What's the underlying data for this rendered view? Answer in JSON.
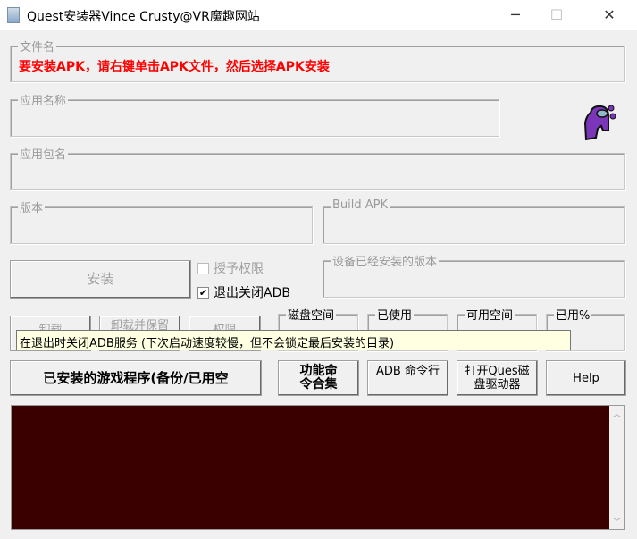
{
  "window": {
    "title": "Quest安装器Vince Crusty@VR魔趣网站",
    "minimize": "─",
    "maximize": "☐",
    "close": "✕"
  },
  "file_group": {
    "label": "文件名",
    "message": "要安装APK，请右键单击APK文件，然后选择APK安装",
    "message_color": "#ff0000"
  },
  "app_name": {
    "label": "应用名称"
  },
  "package_name": {
    "label": "应用包名"
  },
  "version": {
    "label": "版本"
  },
  "build_apk": {
    "label": "Build APK"
  },
  "install_button": "安装",
  "grant_permissions": {
    "label": "授予权限",
    "checked": false
  },
  "exit_close_adb": {
    "label": "退出关闭ADB",
    "checked": true
  },
  "installed_version": {
    "label": "设备已经安装的版本"
  },
  "uninstall_buttons": [
    "卸载",
    "卸载并保留",
    "权限"
  ],
  "disk": {
    "space": "磁盘空间",
    "used": "已使用",
    "free": "可用空间",
    "used_pct": "已用%"
  },
  "tooltip": "在退出时关闭ADB服务 (下次启动速度较慢，但不会锁定最后安装的目录)",
  "buttons": {
    "installed_games": "已安装的游戏程序(备份/已用空",
    "commands": "功能命令合集",
    "adb_cmd": "ADB 命令行",
    "open_drive": "打开Ques磁盘驱动器",
    "help": "Help"
  },
  "icons": {
    "app": "app-window-icon",
    "mascot": "among-us-purple-icon"
  },
  "colors": {
    "console_bg": "#3a0000"
  }
}
